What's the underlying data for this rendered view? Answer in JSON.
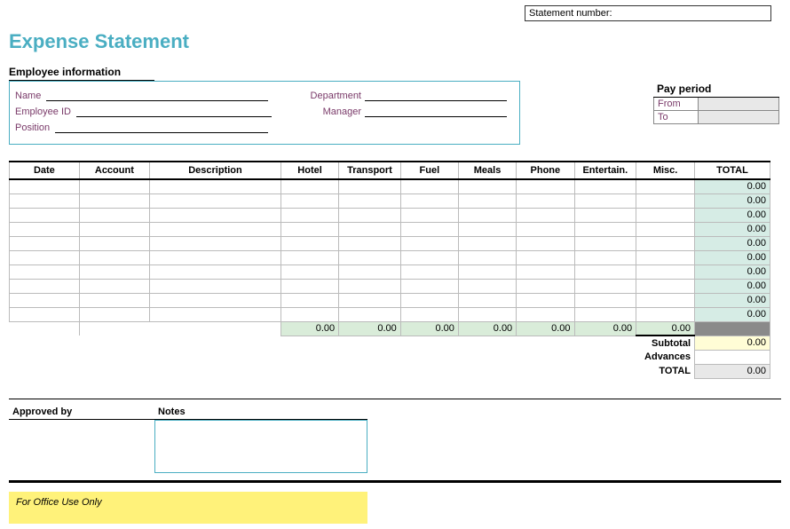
{
  "top": {
    "statement_number_label": "Statement number:"
  },
  "title": "Expense Statement",
  "emp": {
    "header": "Employee information",
    "name_lbl": "Name",
    "dept_lbl": "Department",
    "id_lbl": "Employee ID",
    "mgr_lbl": "Manager",
    "pos_lbl": "Position"
  },
  "pay": {
    "header": "Pay period",
    "from_lbl": "From",
    "to_lbl": "To"
  },
  "cols": {
    "date": "Date",
    "account": "Account",
    "desc": "Description",
    "hotel": "Hotel",
    "transport": "Transport",
    "fuel": "Fuel",
    "meals": "Meals",
    "phone": "Phone",
    "entertain": "Entertain.",
    "misc": "Misc.",
    "total": "TOTAL"
  },
  "rows": [
    {
      "total": "0.00"
    },
    {
      "total": "0.00"
    },
    {
      "total": "0.00"
    },
    {
      "total": "0.00"
    },
    {
      "total": "0.00"
    },
    {
      "total": "0.00"
    },
    {
      "total": "0.00"
    },
    {
      "total": "0.00"
    },
    {
      "total": "0.00"
    },
    {
      "total": "0.00"
    }
  ],
  "col_totals": {
    "hotel": "0.00",
    "transport": "0.00",
    "fuel": "0.00",
    "meals": "0.00",
    "phone": "0.00",
    "entertain": "0.00",
    "misc": "0.00"
  },
  "summary": {
    "subtotal_lbl": "Subtotal",
    "subtotal_val": "0.00",
    "advances_lbl": "Advances",
    "total_lbl": "TOTAL",
    "total_val": "0.00"
  },
  "approve": {
    "approved_lbl": "Approved by",
    "notes_lbl": "Notes"
  },
  "office_use": "For Office Use Only"
}
